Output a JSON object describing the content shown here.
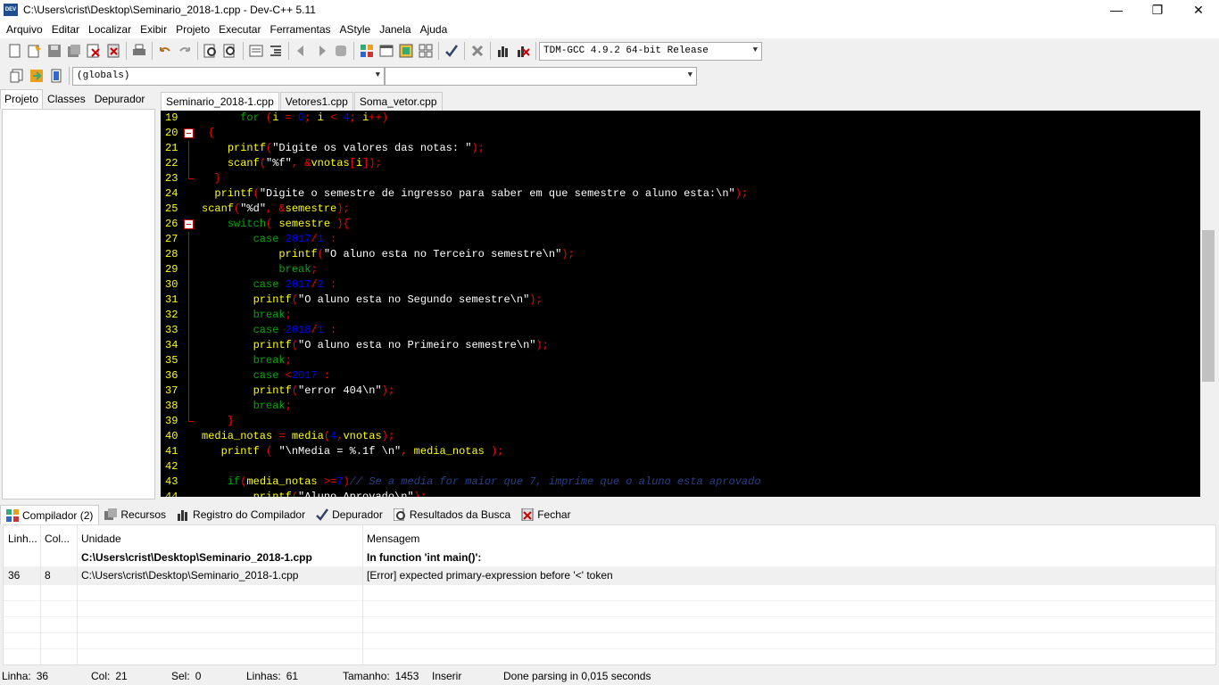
{
  "window": {
    "title": "C:\\Users\\crist\\Desktop\\Seminario_2018-1.cpp - Dev-C++ 5.11",
    "icon_text": "DEV",
    "minimize_glyph": "—",
    "maximize_glyph": "❐",
    "close_glyph": "✕"
  },
  "menu": [
    "Arquivo",
    "Editar",
    "Localizar",
    "Exibir",
    "Projeto",
    "Executar",
    "Ferramentas",
    "AStyle",
    "Janela",
    "Ajuda"
  ],
  "toolbar": {
    "compiler_select": "TDM-GCC 4.9.2 64-bit Release",
    "scope_select": "(globals)",
    "symbol_select": ""
  },
  "left_tabs": [
    "Projeto",
    "Classes",
    "Depurador"
  ],
  "editor_tabs": [
    "Seminario_2018-1.cpp",
    "Vetores1.cpp",
    "Soma_vetor.cpp"
  ],
  "code_lines": [
    {
      "n": "19",
      "text": "      for (i = 0; i < 4; i++)"
    },
    {
      "n": "20",
      "text": " {"
    },
    {
      "n": "21",
      "text": "    printf(\"Digite os valores das notas: \");"
    },
    {
      "n": "22",
      "text": "    scanf(\"%f\", &vnotas[i]);"
    },
    {
      "n": "23",
      "text": "  }"
    },
    {
      "n": "24",
      "text": "  printf(\"Digite o semestre de ingresso para saber em que semestre o aluno esta:\\n\");"
    },
    {
      "n": "25",
      "text": "scanf(\"%d\", &semestre);"
    },
    {
      "n": "26",
      "text": "    switch( semestre ){"
    },
    {
      "n": "27",
      "text": "        case 2017/1 :"
    },
    {
      "n": "28",
      "text": "            printf(\"O aluno esta no Terceiro semestre\\n\");"
    },
    {
      "n": "29",
      "text": "            break;"
    },
    {
      "n": "30",
      "text": "        case 2017/2 :"
    },
    {
      "n": "31",
      "text": "        printf(\"O aluno esta no Segundo semestre\\n\");"
    },
    {
      "n": "32",
      "text": "        break;"
    },
    {
      "n": "33",
      "text": "        case 2018/1 :"
    },
    {
      "n": "34",
      "text": "        printf(\"O aluno esta no Primeiro semestre\\n\");"
    },
    {
      "n": "35",
      "text": "        break;"
    },
    {
      "n": "36",
      "text": "        case <2017 :"
    },
    {
      "n": "37",
      "text": "        printf(\"error 404\\n\");"
    },
    {
      "n": "38",
      "text": "        break;"
    },
    {
      "n": "39",
      "text": "    }"
    },
    {
      "n": "40",
      "text": "media_notas = media(4,vnotas);"
    },
    {
      "n": "41",
      "text": "   printf ( \"\\nMedia = %.1f \\n\", media_notas );"
    },
    {
      "n": "42",
      "text": ""
    },
    {
      "n": "43",
      "text": "    if(media_notas >=7)// Se a media for maior que 7, imprime que o aluno esta aprovado"
    },
    {
      "n": "44",
      "text": "        printf(\"Aluno Aprovado\\n\");"
    }
  ],
  "bottom_tabs": [
    "Compilador (2)",
    "Recursos",
    "Registro do Compilador",
    "Depurador",
    "Resultados da Busca",
    "Fechar"
  ],
  "messages": {
    "columns": [
      "Linh...",
      "Col...",
      "Unidade",
      "Mensagem"
    ],
    "rows": [
      {
        "line": "",
        "col": "",
        "unit": "C:\\Users\\crist\\Desktop\\Seminario_2018-1.cpp",
        "msg": "In function 'int main()':",
        "bold": true
      },
      {
        "line": "36",
        "col": "8",
        "unit": "C:\\Users\\crist\\Desktop\\Seminario_2018-1.cpp",
        "msg": "[Error] expected primary-expression before '<' token",
        "bold": false
      }
    ]
  },
  "status": {
    "linha_label": "Linha:",
    "linha": "36",
    "col_label": "Col:",
    "col": "21",
    "sel_label": "Sel:",
    "sel": "0",
    "linhas_label": "Linhas:",
    "linhas": "61",
    "tamanho_label": "Tamanho:",
    "tamanho": "1453",
    "mode": "Inserir",
    "parse": "Done parsing in 0,015 seconds"
  }
}
